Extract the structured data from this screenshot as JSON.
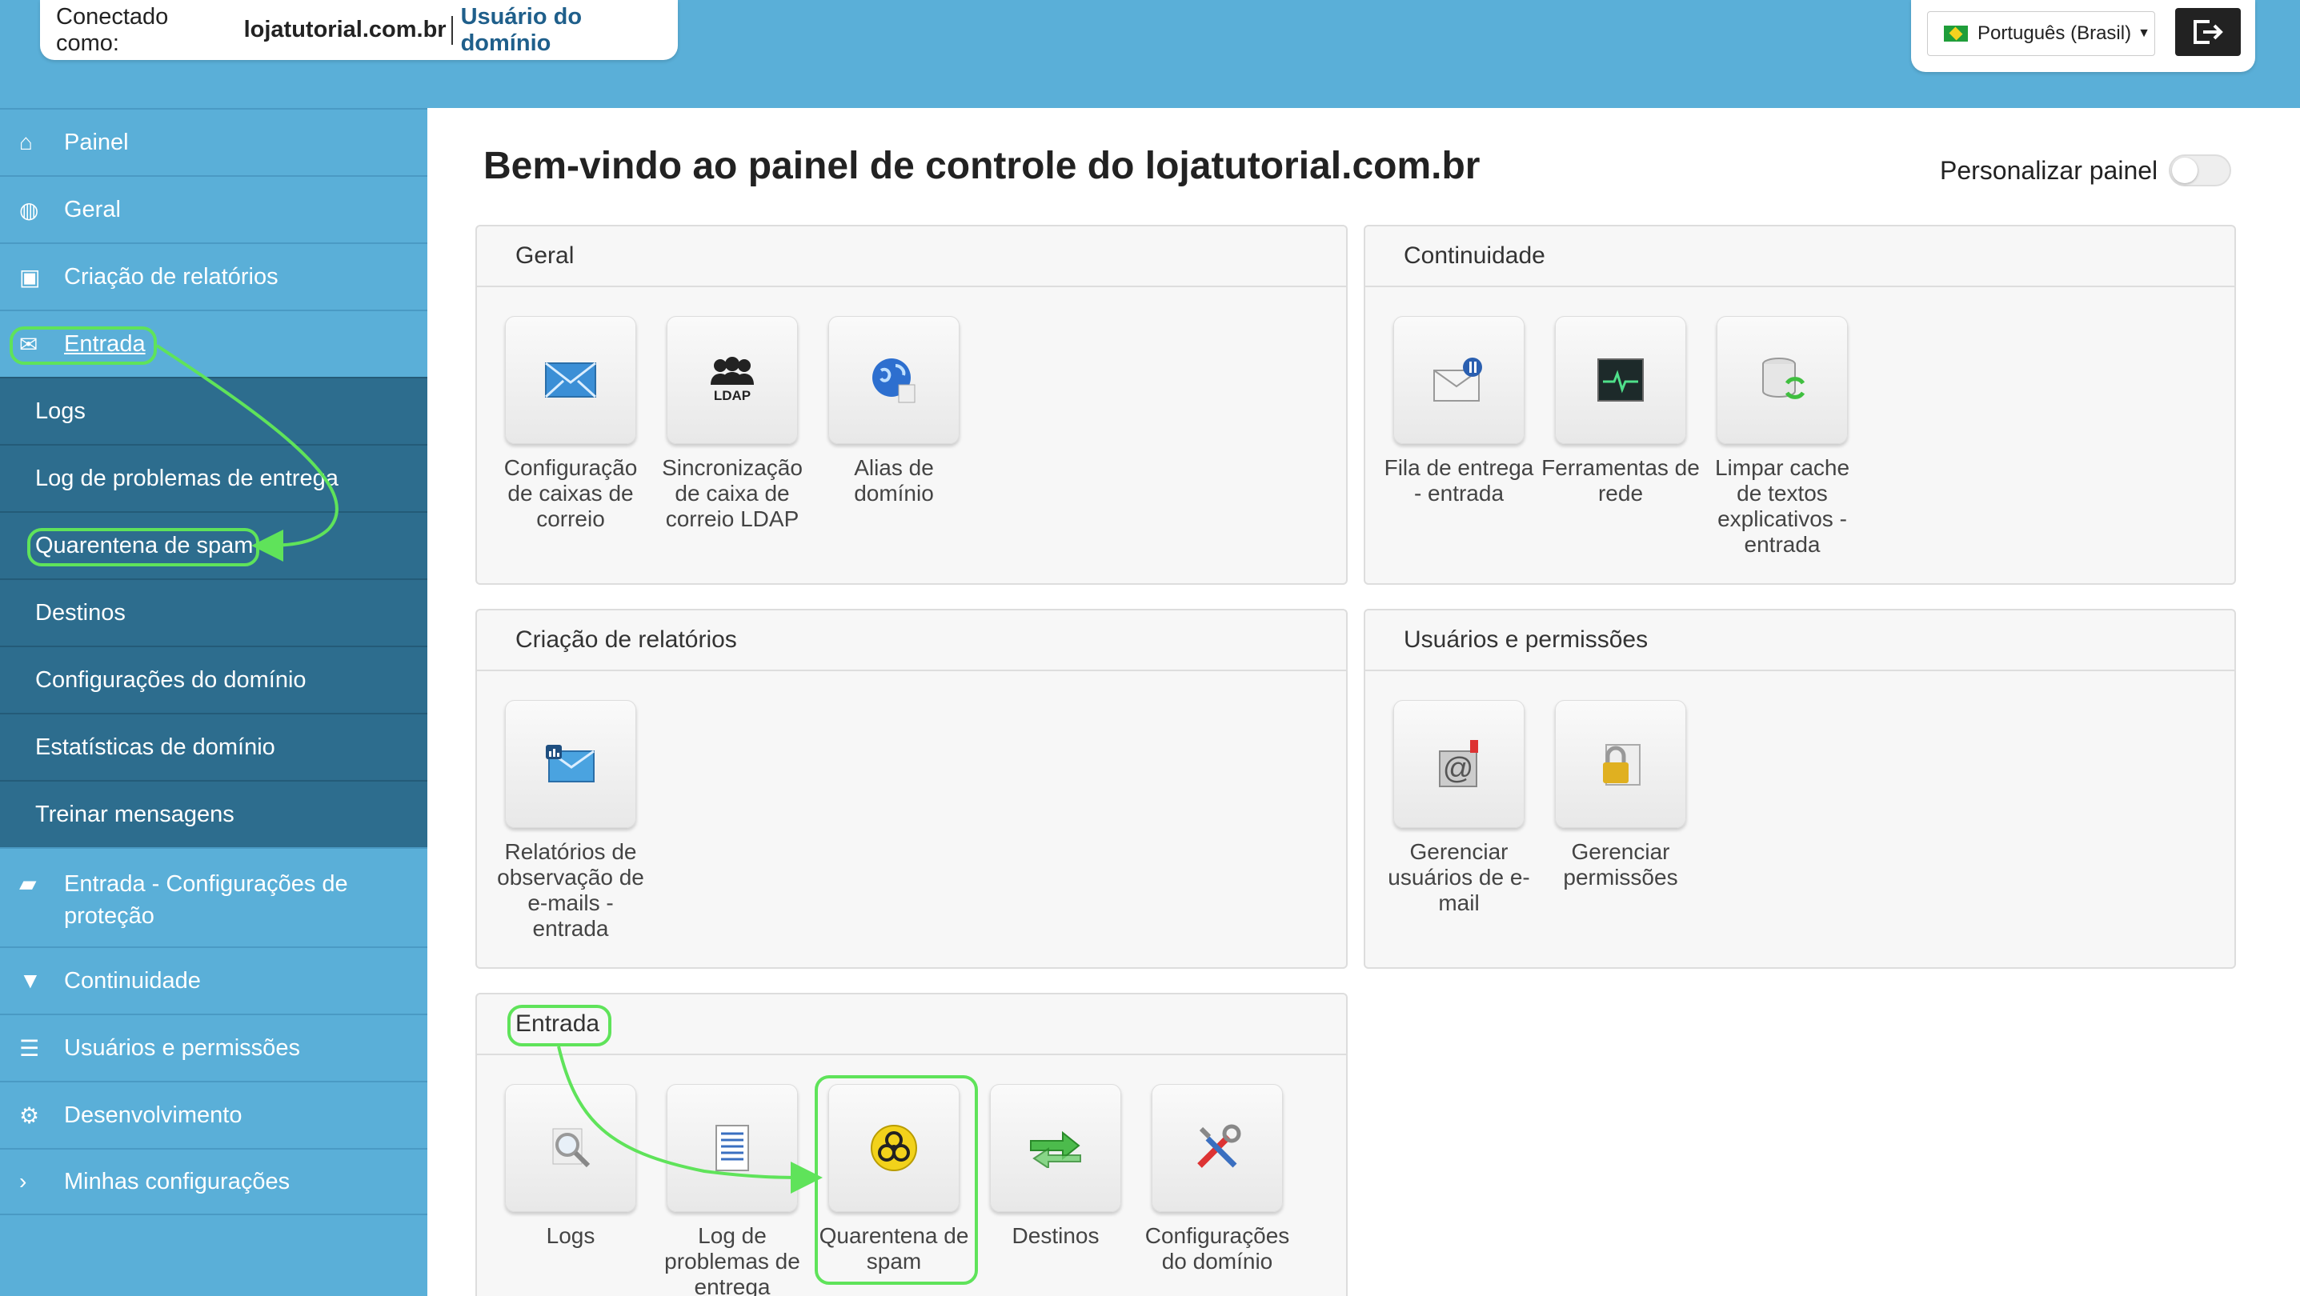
{
  "header": {
    "connected_label": "Conectado como:",
    "connected_domain": "lojatutorial.com.br",
    "role": "Usuário do domínio",
    "language": "Português (Brasil)",
    "logout_icon": "logout-icon"
  },
  "sidebar": {
    "items": [
      {
        "label": "Painel",
        "icon": "home-icon"
      },
      {
        "label": "Geral",
        "icon": "globe-icon"
      },
      {
        "label": "Criação de relatórios",
        "icon": "inbox-icon"
      },
      {
        "label": "Entrada",
        "icon": "envelope-icon"
      },
      {
        "label": "Entrada - Configurações de proteção",
        "icon": "folder-open-icon"
      },
      {
        "label": "Continuidade",
        "icon": "filter-icon"
      },
      {
        "label": "Usuários e permissões",
        "icon": "list-icon"
      },
      {
        "label": "Desenvolvimento",
        "icon": "gear-icon"
      },
      {
        "label": "Minhas configurações",
        "icon": "chevron-right-icon"
      }
    ],
    "entrada_sub": [
      "Logs",
      "Log de problemas de entrega",
      "Quarentena de spam",
      "Destinos",
      "Configurações do domínio",
      "Estatísticas de domínio",
      "Treinar mensagens"
    ]
  },
  "main": {
    "title": "Bem-vindo ao painel de controle do lojatutorial.com.br",
    "personalize_label": "Personalizar painel",
    "panels": {
      "geral": {
        "title": "Geral",
        "tiles": [
          "Configuração de caixas de correio",
          "Sincronização de caixa de correio LDAP",
          "Alias de domínio"
        ]
      },
      "continuidade": {
        "title": "Continuidade",
        "tiles": [
          "Fila de entrega - entrada",
          "Ferramentas de rede",
          "Limpar cache de textos explicativos - entrada"
        ]
      },
      "relatorios": {
        "title": "Criação de relatórios",
        "tiles": [
          "Relatórios de observação de e-mails - entrada"
        ]
      },
      "usuarios": {
        "title": "Usuários e permissões",
        "tiles": [
          "Gerenciar usuários de e-mail",
          "Gerenciar permissões"
        ]
      },
      "entrada": {
        "title": "Entrada",
        "tiles": [
          "Logs",
          "Log de problemas de entrega",
          "Quarentena de spam",
          "Destinos",
          "Configurações do domínio"
        ]
      }
    }
  },
  "colors": {
    "sidebar": "#5aafd8",
    "submenu": "#2d6d8e",
    "highlight": "#5fe35a"
  }
}
